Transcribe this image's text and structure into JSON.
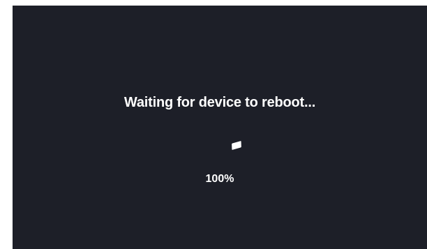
{
  "status": {
    "message": "Waiting for device to reboot...",
    "progress_label": "100%",
    "progress_value": 100
  },
  "icons": {
    "spinner": "loading-spinner-icon"
  },
  "colors": {
    "screen_background": "#1d1f28",
    "text": "#ffffff"
  }
}
